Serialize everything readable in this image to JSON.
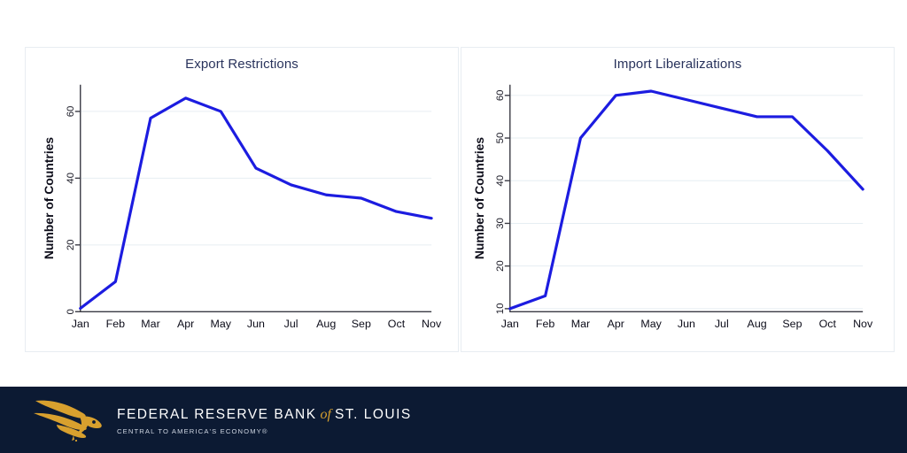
{
  "chart_data": [
    {
      "type": "line",
      "title": "Export Restrictions",
      "xlabel": "",
      "ylabel": "Number of Countries",
      "categories": [
        "Jan",
        "Feb",
        "Mar",
        "Apr",
        "May",
        "Jun",
        "Jul",
        "Aug",
        "Sep",
        "Oct",
        "Nov"
      ],
      "values": [
        1,
        9,
        58,
        64,
        60,
        43,
        38,
        35,
        34,
        30,
        28
      ],
      "yticks": [
        0,
        20,
        40,
        60
      ],
      "ylim": [
        0,
        68
      ],
      "grid": true,
      "legend": "none",
      "series_color": "#1c1ce0"
    },
    {
      "type": "line",
      "title": "Import Liberalizations",
      "xlabel": "",
      "ylabel": "Number of Countries",
      "categories": [
        "Jan",
        "Feb",
        "Mar",
        "Apr",
        "May",
        "Jun",
        "Jul",
        "Aug",
        "Sep",
        "Oct",
        "Nov"
      ],
      "values": [
        10,
        13,
        50,
        60,
        61,
        59,
        57,
        55,
        55,
        47,
        38
      ],
      "yticks": [
        10,
        20,
        30,
        40,
        50,
        60
      ],
      "ylim": [
        9.3,
        62.5
      ],
      "grid": true,
      "legend": "none",
      "series_color": "#1c1ce0"
    }
  ],
  "footer": {
    "logo_icon": "eagle-icon",
    "wordmark_part1": "FEDERAL RESERVE BANK",
    "wordmark_of": "of",
    "wordmark_part2": "ST. LOUIS",
    "tagline": "CENTRAL TO AMERICA'S ECONOMY®",
    "background_color": "#0c1a33",
    "gold_color": "#d8a02e"
  }
}
